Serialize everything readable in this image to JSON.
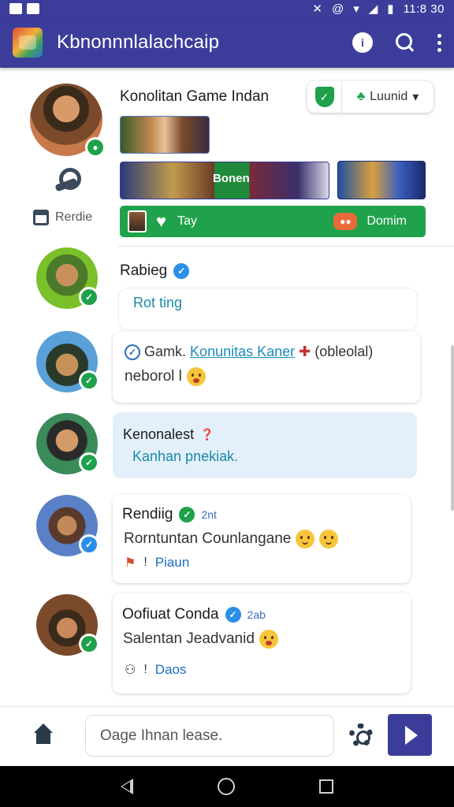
{
  "status_bar": {
    "time": "11:8 30"
  },
  "app_bar": {
    "title": "Kbnonnnlalachcaip",
    "badge": "i"
  },
  "post_main": {
    "author": "Konolitan Game Indan",
    "language_chip": "Luunid",
    "banner_label": "Bonen",
    "green_bar": {
      "left": "Tay",
      "right": "Domim"
    },
    "side_label": "Rerdie"
  },
  "feed": [
    {
      "name": "Rabieg",
      "text": "Rot ting"
    },
    {
      "prefix": "Gamk.",
      "link": "Konunitas Kaner",
      "suffix": "(obleolal)",
      "text2": "neborol l"
    },
    {
      "name": "Kenonalest",
      "text": "Kanhan pnekiak."
    },
    {
      "name": "Rendiig",
      "time": "2nt",
      "text": "Rorntuntan Counlangane",
      "action": "Piaun"
    },
    {
      "name": "Oofiuat Conda",
      "time": "2ab",
      "text": "Salentan Jeadvanid",
      "action": "Daos"
    }
  ],
  "composer": {
    "placeholder": "Oage Ihnan lease."
  },
  "colors": {
    "primary": "#3c3d9b",
    "accent_green": "#1fa24b",
    "verified_blue": "#2b8ee8"
  }
}
